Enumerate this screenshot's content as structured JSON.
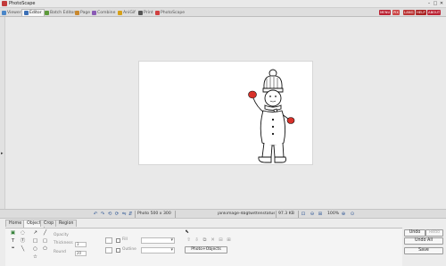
{
  "window": {
    "title": "PhotoScape",
    "controls": {
      "minimize": "–",
      "maximize": "□",
      "close": "✕"
    }
  },
  "app_tabs": [
    {
      "label": "Viewer",
      "icon": "viewer-icon",
      "color": "#4a86c8"
    },
    {
      "label": "Editor",
      "icon": "editor-icon",
      "color": "#3b6fb5"
    },
    {
      "label": "Batch Editor",
      "icon": "batch-editor-icon",
      "color": "#5c9a3a"
    },
    {
      "label": "Page",
      "icon": "page-icon",
      "color": "#c8882e"
    },
    {
      "label": "Combine",
      "icon": "combine-icon",
      "color": "#8a5ab5"
    },
    {
      "label": "AniGif",
      "icon": "anigif-icon",
      "color": "#d6a019"
    },
    {
      "label": "Print",
      "icon": "print-icon",
      "color": "#555555"
    },
    {
      "label": "PhotoScape",
      "icon": "photoscape-icon",
      "color": "#d04040"
    }
  ],
  "top_right_badges": [
    "MENU",
    "PIX",
    "LANG",
    "HELP",
    "ABOUT"
  ],
  "status_bar": {
    "photo_size": "Photo 500 x 300",
    "filename": "jankimage-4bgtwittenstatus.png",
    "file_size": "97.3 KB",
    "zoom": "100%",
    "icons": [
      "rotate-left-icon",
      "rotate-right-icon",
      "rotate-left-90-icon",
      "rotate-right-90-icon",
      "flip-horizontal-icon",
      "flip-vertical-icon"
    ]
  },
  "panel_tabs": [
    "Home",
    "Object",
    "Crop",
    "Region"
  ],
  "object_panel": {
    "opacity_label": "Opacity",
    "thickness_label": "Thickness",
    "thickness_value": "3",
    "round_label": "Round",
    "round_value": "20",
    "fill_label": "Fill",
    "outline_label": "Outline",
    "photo_objects_button": "Photo+Objects"
  },
  "history_buttons": {
    "undo": "Undo",
    "redo": "Redo",
    "undo_all": "Undo All",
    "save": "Save"
  },
  "canvas": {
    "background": "#ffffff"
  }
}
